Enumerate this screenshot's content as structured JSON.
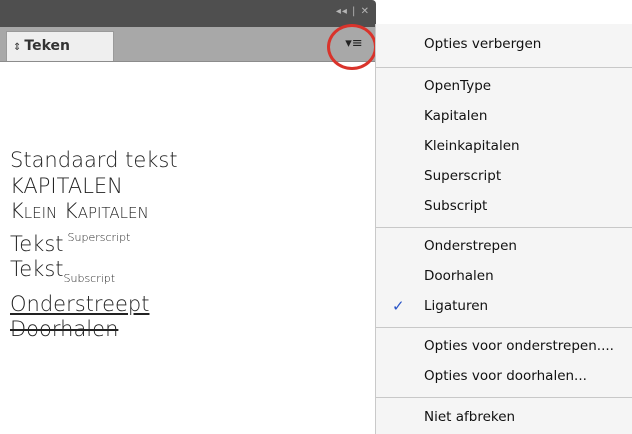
{
  "panel": {
    "title_controls": "◂◂ | ✕",
    "tab_label": "Teken",
    "tab_arrows": "⇕",
    "menu_button_glyph": "▾≡"
  },
  "preview": {
    "standaard": "Standaard tekst",
    "kapitalen": "KAPITALEN",
    "klein_kapitalen": "Klein Kapitalen",
    "superscript_base": "Tekst",
    "superscript_text": "Superscript",
    "subscript_base": "Tekst",
    "subscript_text": "Subscript",
    "onderstreept": "Onderstreept",
    "doorhalen": "Doorhalen"
  },
  "menu": {
    "items": [
      {
        "label": "Opties verbergen",
        "checked": false
      },
      {
        "label": "OpenType",
        "checked": false
      },
      {
        "label": "Kapitalen",
        "checked": false
      },
      {
        "label": "Kleinkapitalen",
        "checked": false
      },
      {
        "label": "Superscript",
        "checked": false
      },
      {
        "label": "Subscript",
        "checked": false
      },
      {
        "label": "Onderstrepen",
        "checked": false
      },
      {
        "label": "Doorhalen",
        "checked": false
      },
      {
        "label": "Ligaturen",
        "checked": true
      },
      {
        "label": "Opties voor onderstrepen....",
        "checked": false
      },
      {
        "label": "Opties voor doorhalen...",
        "checked": false
      },
      {
        "label": "Niet afbreken",
        "checked": false
      }
    ],
    "check_glyph": "✓"
  },
  "colors": {
    "highlight_circle": "#d9332b",
    "check_mark": "#2a55c7"
  }
}
